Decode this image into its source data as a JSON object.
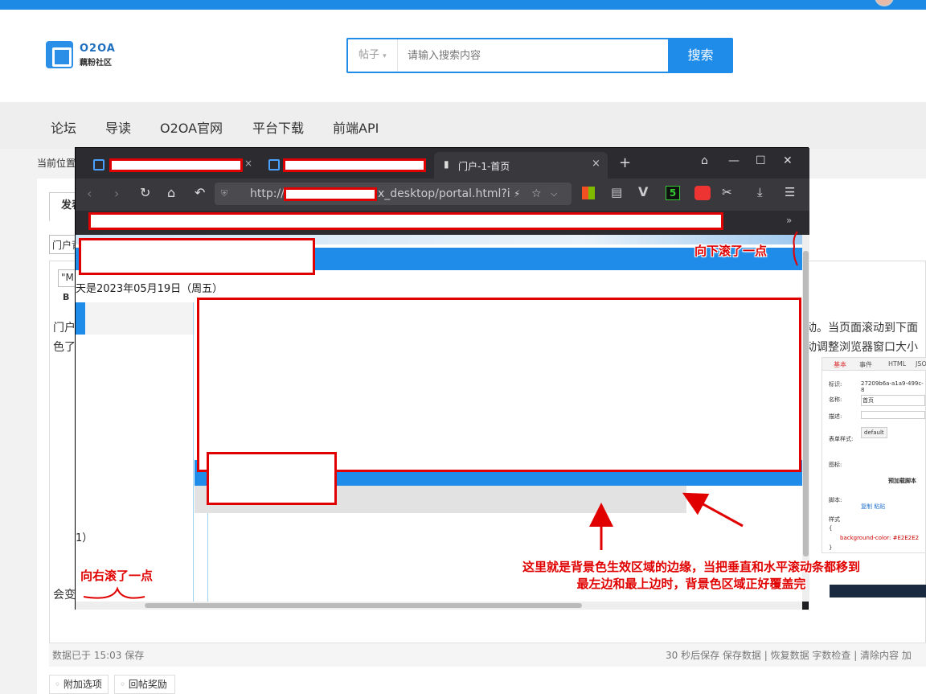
{
  "site": {
    "logo_title": "O2OA",
    "logo_sub": "藕粉社区",
    "search_type": "帖子",
    "search_placeholder": "请输入搜索内容",
    "search_button": "搜索"
  },
  "nav": {
    "items": [
      "论坛",
      "导读",
      "O2OA官网",
      "平台下载",
      "前端API"
    ]
  },
  "breadcrumb": "当前位置",
  "editor": {
    "tab_label": "发表",
    "subject_value": "门户背",
    "font_select": "\"Mi",
    "bold_label": "B",
    "body_line1": "门户",
    "body_line2": "色了",
    "body_line3": "会变",
    "body_right1": "动。当页面滚动到下面",
    "body_right2": "动调整浏览器窗口大小",
    "status_left": "数据已于 15:03 保存",
    "status_right": "30 秒后保存 保存数据 | 恢复数据    字数检查 | 清除内容    加",
    "option1": "附加选项",
    "option2": "回帖奖励"
  },
  "devtools": {
    "tabs": [
      "基本",
      "事件",
      "HTML",
      "JSO"
    ],
    "id_label": "标识:",
    "id_value": "27209b6a-a1a9-499c-8",
    "name_label": "名称:",
    "name_value": "首页",
    "desc_label": "描述:",
    "style_label": "表单样式:",
    "style_value": "default",
    "icon_label": "图标:",
    "preload_label": "预加载脚本",
    "script_label": "脚本:",
    "script_actions": "复制  粘贴",
    "css_section": "样式",
    "css_open": "{",
    "css_rule": "background-color: #E2E2E2",
    "css_close": "}"
  },
  "browser": {
    "active_tab_label": "门户-1-首页",
    "address_prefix": "http://",
    "address_suffix": "x_desktop/portal.html?i",
    "bookmark_more": "»",
    "page_date": "天是2023年05月19日（周五）",
    "page_frag": "1）"
  },
  "annotations": {
    "scrolled_down": "向下滚了一点",
    "scrolled_right": "向右滚了一点",
    "edge_note_line1": "这里就是背景色生效区域的边缘，当把垂直和水平滚动条都移到",
    "edge_note_line2": "最左边和最上边时，背景色区域正好覆盖完"
  },
  "colors": {
    "brand_blue": "#1e8ce8",
    "annotation_red": "#e00000",
    "bg_gray": "#E2E2E2"
  }
}
